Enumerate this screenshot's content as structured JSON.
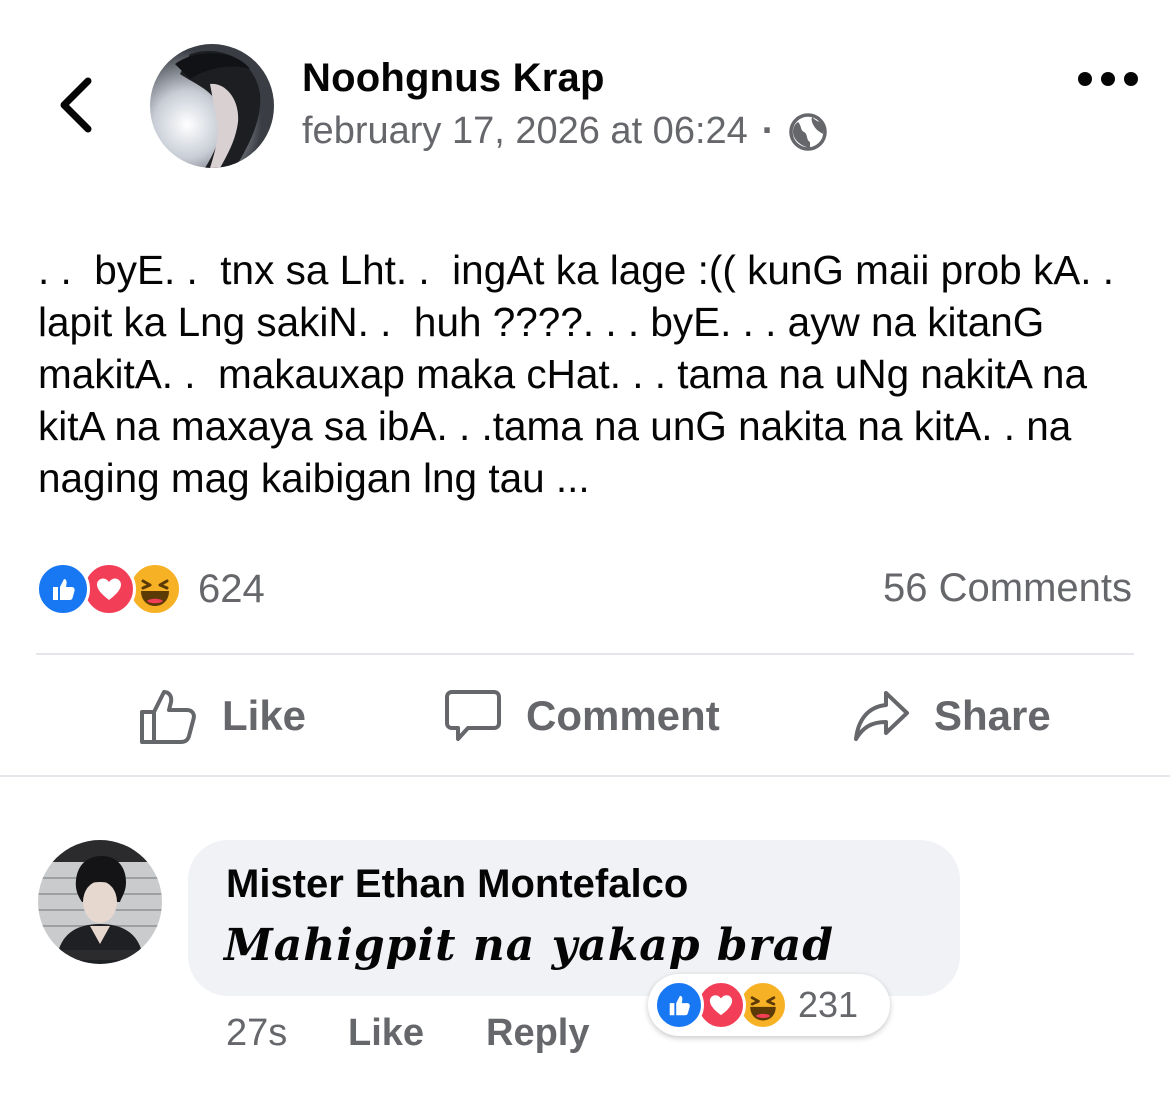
{
  "post": {
    "author": "Noohgnus Krap",
    "timestamp": "february 17, 2026 at 06:24",
    "separator": "·",
    "audience_icon": "globe-icon",
    "text": ". .  byE. .  tnx sa Lht. .  ingAt ka lage :(( kunG maii prob kA. . lapit ka Lng sakiN. .  huh ????. . . byE. . . ayw na kitanG makitA. .  makauxap maka cHat. . . tama na uNg nakitA na kitA na maxaya sa ibA. . .tama na unG nakita na kitA. . na naging mag kaibigan lng tau ...",
    "reactions": {
      "count": "624",
      "types": [
        "like",
        "love",
        "haha"
      ]
    },
    "comments_count": "56 Comments"
  },
  "actions": {
    "like": "Like",
    "comment": "Comment",
    "share": "Share"
  },
  "comment": {
    "author": "Mister Ethan Montefalco",
    "text": "Mahigpit na yakap brad",
    "time": "27s",
    "like_label": "Like",
    "reply_label": "Reply",
    "reactions": {
      "count": "231",
      "types": [
        "like",
        "love",
        "haha"
      ]
    }
  },
  "colors": {
    "like_blue": "#1877f2",
    "love_red": "#f33e58",
    "haha_yellow": "#f7b125",
    "secondary_text": "#65676b",
    "bubble_bg": "#f0f2f5"
  }
}
